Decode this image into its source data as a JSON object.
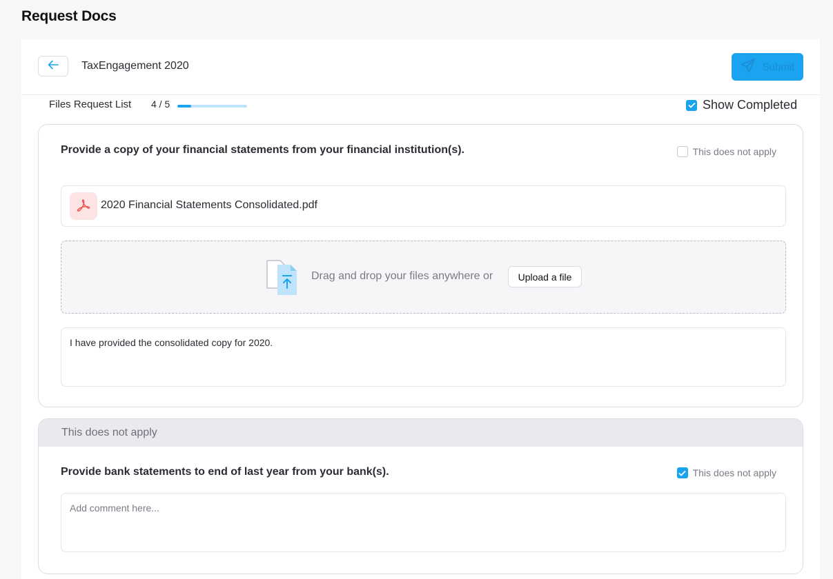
{
  "page": {
    "title": "Request Docs"
  },
  "header": {
    "engagement_title": "TaxEngagement 2020",
    "submit_label": "Submit",
    "back_icon": "arrow-left-icon",
    "submit_icon": "send-icon"
  },
  "progress": {
    "label": "Files Request List",
    "count_text": "4 / 5",
    "fraction": 0.2,
    "show_completed_label": "Show Completed",
    "show_completed_checked": true
  },
  "requests": [
    {
      "title": "Provide a copy of your financial statements from your financial institution(s).",
      "not_apply_label": "This does not apply",
      "not_apply_checked": false,
      "files": [
        {
          "name": "2020 Financial Statements Consolidated.pdf",
          "icon": "pdf-icon"
        }
      ],
      "dropzone_text": "Drag and drop your files anywhere or",
      "upload_label": "Upload a file",
      "comment": "I have provided the consolidated copy for 2020."
    },
    {
      "banner": "This does not apply",
      "title": "Provide bank statements to end of last year from your bank(s).",
      "not_apply_label": "This does not apply",
      "not_apply_checked": true,
      "comment_placeholder": "Add comment here..."
    }
  ],
  "colors": {
    "accent": "#1aa3ee",
    "pdf_bg": "#fde4e4",
    "pdf_red": "#e8564f"
  }
}
